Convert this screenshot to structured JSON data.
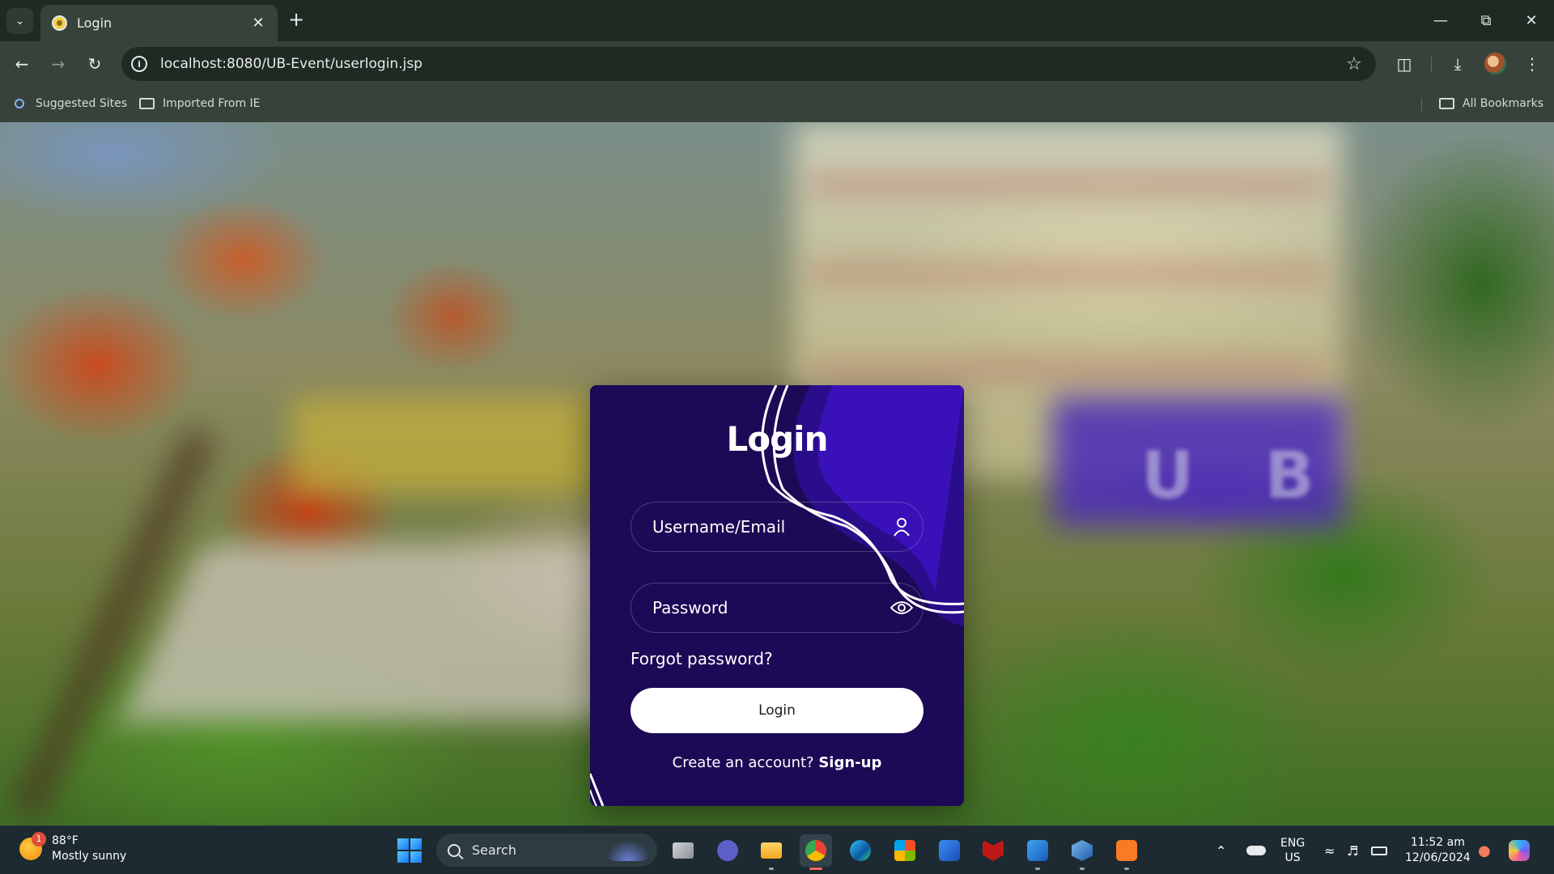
{
  "browser": {
    "tab": {
      "title": "Login"
    },
    "url": "localhost:8080/UB-Event/userlogin.jsp",
    "bookmarks": [
      {
        "label": "Suggested Sites",
        "icon": "search-icon"
      },
      {
        "label": "Imported From IE",
        "icon": "folder-icon"
      }
    ],
    "all_bookmarks_label": "All Bookmarks"
  },
  "background": {
    "banner_text": "U B"
  },
  "login": {
    "title": "Login",
    "username_placeholder": "Username/Email",
    "password_placeholder": "Password",
    "forgot_label": "Forgot password?",
    "submit_label": "Login",
    "signup_prompt": "Create an account?",
    "signup_link": "Sign-up",
    "colors": {
      "card": "#1c0a56",
      "accent": "#3a10b8",
      "button": "#ffffff"
    }
  },
  "taskbar": {
    "weather": {
      "temp": "88°F",
      "condition": "Mostly sunny",
      "badge": "1"
    },
    "search_label": "Search",
    "apps": [
      "task-view",
      "meet",
      "file-explorer",
      "chrome",
      "edge",
      "microsoft-store",
      "visual-studio-code-alt",
      "mcafee",
      "word",
      "virtualbox",
      "xampp"
    ],
    "language": {
      "lang": "ENG",
      "region": "US"
    },
    "clock": {
      "time": "11:52 am",
      "date": "12/06/2024"
    }
  }
}
